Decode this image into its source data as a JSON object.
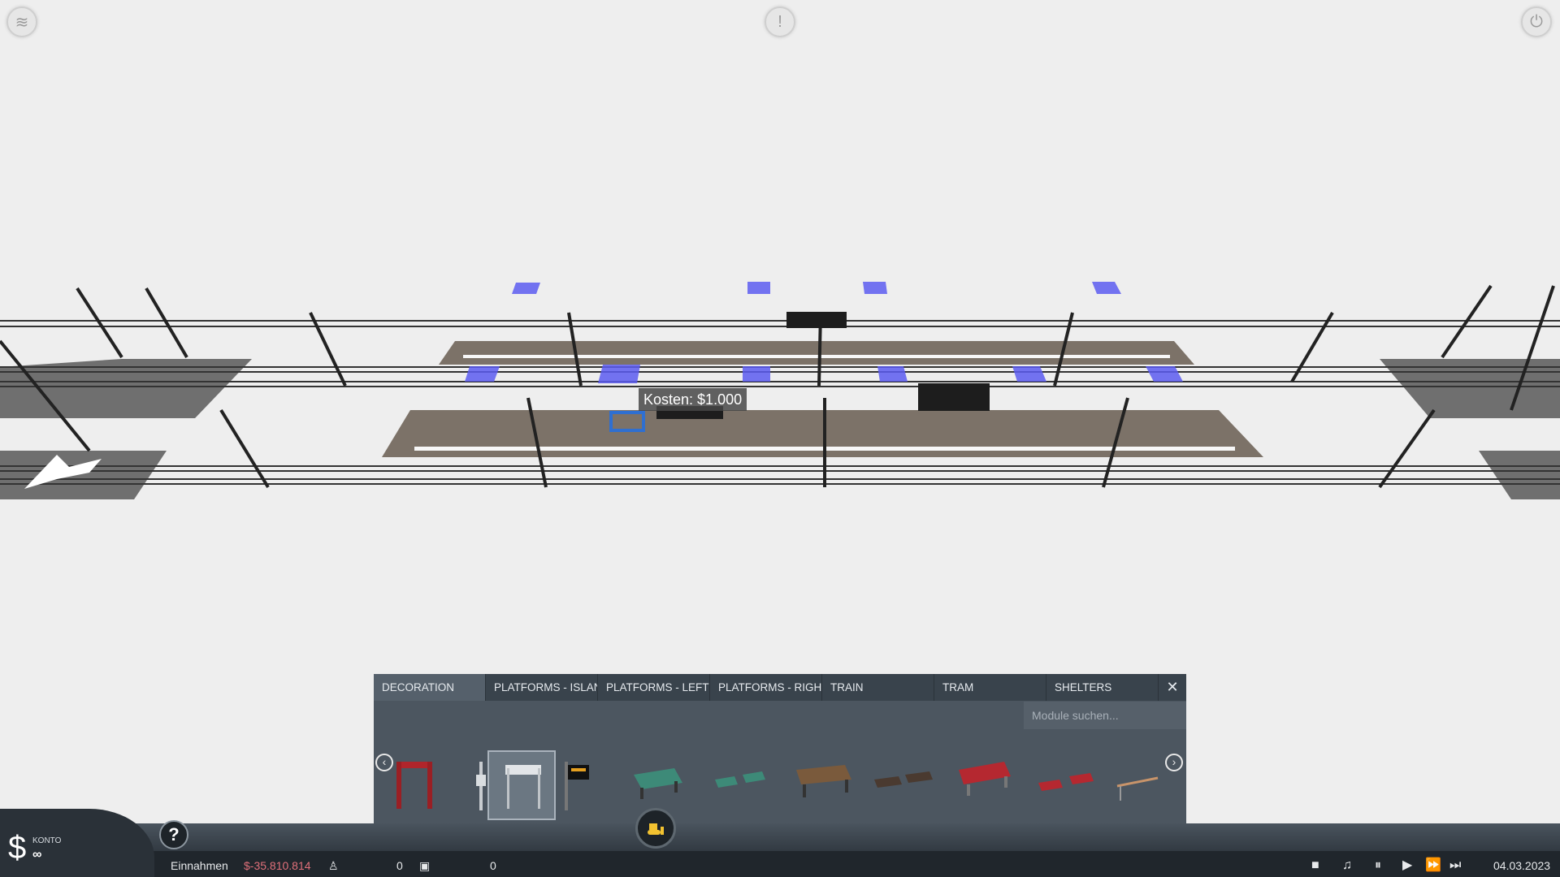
{
  "hud": {
    "layers_icon": "layers-icon",
    "alert_icon": "exclamation-icon",
    "power_icon": "power-icon"
  },
  "tooltip": {
    "cost_label": "Kosten: $1.000"
  },
  "module_panel": {
    "tabs": [
      {
        "label": "DECORATION",
        "active": true
      },
      {
        "label": "PLATFORMS - ISLAND",
        "active": false
      },
      {
        "label": "PLATFORMS - LEFT",
        "active": false
      },
      {
        "label": "PLATFORMS - RIGHT",
        "active": false
      },
      {
        "label": "TRAIN",
        "active": false
      },
      {
        "label": "TRAM",
        "active": false
      },
      {
        "label": "SHELTERS",
        "active": false
      }
    ],
    "close_icon": "close-icon",
    "search_placeholder": "Module suchen...",
    "modules": [
      {
        "name": "red-gate-module",
        "selected": false
      },
      {
        "name": "sign-post-module",
        "selected": false
      },
      {
        "name": "station-sign-module",
        "selected": true
      },
      {
        "name": "departure-board-module",
        "selected": false
      },
      {
        "name": "green-bench-module",
        "selected": false
      },
      {
        "name": "green-bench-pair-module",
        "selected": false
      },
      {
        "name": "wooden-bench-module",
        "selected": false
      },
      {
        "name": "dark-bench-pair-module",
        "selected": false
      },
      {
        "name": "red-bench-module",
        "selected": false
      },
      {
        "name": "red-bench-pair-module",
        "selected": false
      },
      {
        "name": "railing-module",
        "selected": false
      }
    ]
  },
  "bottom_bar": {
    "account_label": "KONTO",
    "account_value": "∞",
    "currency_symbol": "$",
    "income_label": "Einnahmen",
    "income_value": "$-35.810.814",
    "passengers_value": "0",
    "cargo_value": "0",
    "date": "04.03.2023",
    "income_color": "#e0707a"
  }
}
